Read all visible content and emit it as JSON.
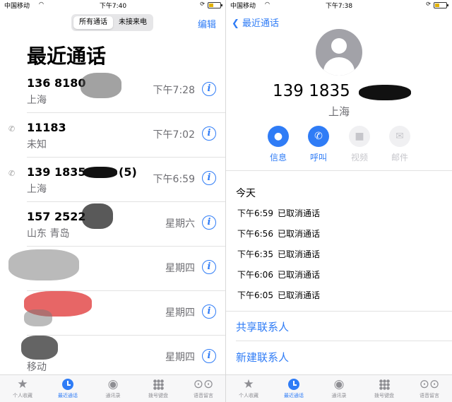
{
  "left": {
    "status": {
      "carrier": "中国移动",
      "time": "下午7:40"
    },
    "segments": [
      "所有通话",
      "未接来电"
    ],
    "edit_label": "编辑",
    "title": "最近通话",
    "calls": [
      {
        "number": "136 8180",
        "location": "上海",
        "time": "下午7:28",
        "incoming": false
      },
      {
        "number": "11183",
        "location": "未知",
        "time": "下午7:02",
        "incoming": true
      },
      {
        "number": "139 1835",
        "count": "(5)",
        "location": "上海",
        "time": "下午6:59",
        "incoming": true
      },
      {
        "number": "157 2522",
        "location": "山东 青岛",
        "time": "星期六",
        "incoming": false
      },
      {
        "number": "",
        "location": "",
        "time": "星期四",
        "incoming": false
      },
      {
        "number": "",
        "location": "",
        "time": "星期四",
        "incoming": false
      },
      {
        "number": "",
        "location": "移动",
        "time": "星期四",
        "incoming": false
      }
    ]
  },
  "right": {
    "status": {
      "carrier": "中国移动",
      "time": "下午7:38"
    },
    "back_label": "最近通话",
    "number": "139 1835",
    "location": "上海",
    "actions": [
      {
        "label": "信息",
        "icon": "message-icon",
        "enabled": true
      },
      {
        "label": "呼叫",
        "icon": "phone-icon",
        "enabled": true
      },
      {
        "label": "视频",
        "icon": "video-icon",
        "enabled": false
      },
      {
        "label": "邮件",
        "icon": "mail-icon",
        "enabled": false
      }
    ],
    "section_label": "今天",
    "log": [
      {
        "time": "下午6:59",
        "status": "已取消通话"
      },
      {
        "time": "下午6:56",
        "status": "已取消通话"
      },
      {
        "time": "下午6:35",
        "status": "已取消通话"
      },
      {
        "time": "下午6:06",
        "status": "已取消通话"
      },
      {
        "time": "下午6:05",
        "status": "已取消通话"
      }
    ],
    "share_contact": "共享联系人",
    "new_contact": "新建联系人"
  },
  "tabs": [
    {
      "label": "个人收藏",
      "icon": "star-icon"
    },
    {
      "label": "最近通话",
      "icon": "clock-icon"
    },
    {
      "label": "通讯录",
      "icon": "person-circle-icon"
    },
    {
      "label": "拨号键盘",
      "icon": "keypad-icon"
    },
    {
      "label": "语音留言",
      "icon": "voicemail-icon"
    }
  ],
  "active_tab": 1,
  "colors": {
    "accent": "#2f7cf6",
    "secondary_text": "#6d6d72",
    "redaction": "#444444",
    "redaction_red": "#e34b4b"
  }
}
